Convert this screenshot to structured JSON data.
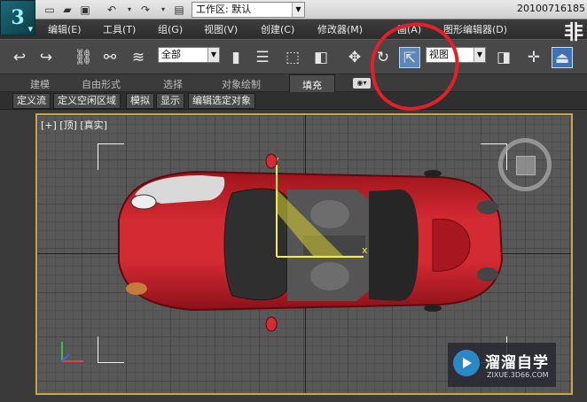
{
  "title_bar": {
    "workspace_value": "工作区: 默认",
    "title_code": "20100716185",
    "quick_access_icons": [
      "new-file-icon",
      "open-folder-icon",
      "save-icon",
      "undo-icon",
      "redo-icon",
      "project-icon"
    ]
  },
  "menu": {
    "items": [
      "编辑(E)",
      "工具(T)",
      "组(G)",
      "视图(V)",
      "创建(C)",
      "修改器(M)",
      "画(A)",
      "图形编辑器(D)"
    ]
  },
  "toolbar": {
    "selection_filter": "全部",
    "reference_coordinate": "视图",
    "highlight_color": "#e3202a"
  },
  "ribbon": {
    "tabs": [
      "建模",
      "自由形式",
      "选择",
      "对象绘制",
      "填充"
    ],
    "active_tab": "填充"
  },
  "subribbon": {
    "buttons": [
      "定义流",
      "定义空闲区域",
      "模拟",
      "显示",
      "编辑选定对象"
    ]
  },
  "viewport": {
    "label": "[+] [顶] [真实]",
    "gizmo_x_label": "x",
    "gizmo_y_label": "y",
    "border_color": "#c8a64a",
    "car_color": "#c4202a"
  },
  "watermark": {
    "title": "溜溜自学",
    "subtitle": "ZIXUE.3D66.COM"
  }
}
